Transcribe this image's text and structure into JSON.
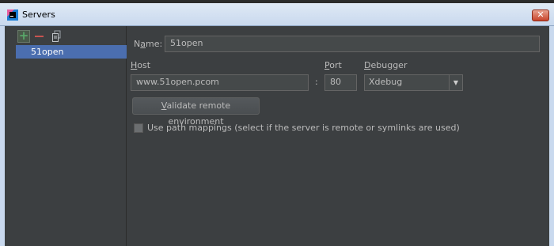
{
  "window": {
    "title": "Servers",
    "close_glyph": "✕"
  },
  "toolbar": {
    "add_icon": "plus-icon",
    "remove_icon": "minus-icon",
    "copy_icon": "copy-icon",
    "add_color": "#59a869",
    "remove_color": "#c75450"
  },
  "server_list": {
    "items": [
      {
        "label": "51open",
        "selected": true
      }
    ]
  },
  "form": {
    "name_label": "Name:",
    "name_value": "51open",
    "host_label": "Host",
    "host_value": "www.51open.pcom",
    "colon": ":",
    "port_label": "Port",
    "port_value": "80",
    "debugger_label": "Debugger",
    "debugger_value": "Xdebug",
    "validate_button": "Validate remote environment",
    "path_mappings_label": "Use path mappings (select if the server is remote or symlinks are used)",
    "path_mappings_checked": false
  },
  "colors": {
    "selection": "#4b6eaf",
    "background": "#3c3f41",
    "field": "#45494a"
  }
}
